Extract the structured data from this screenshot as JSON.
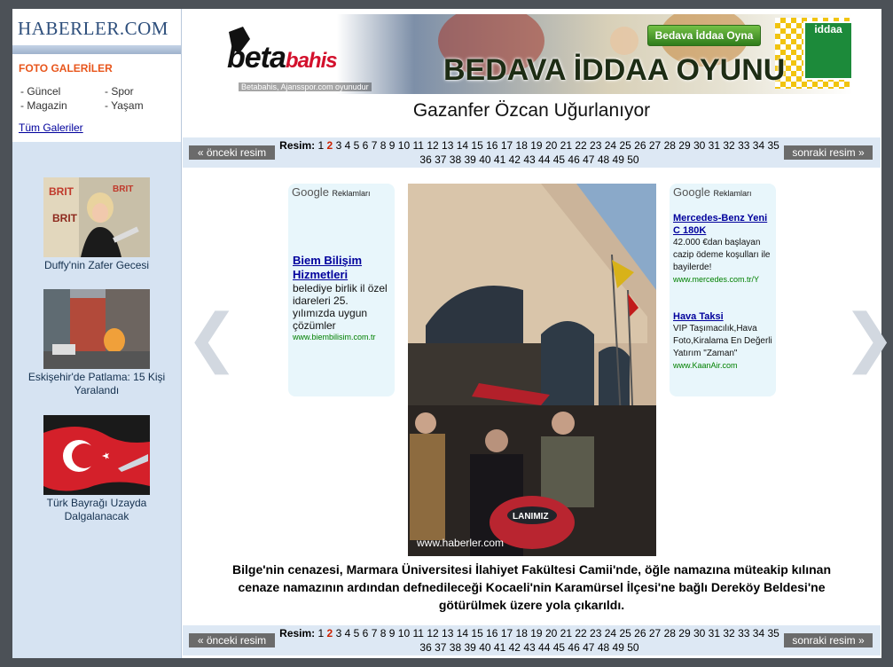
{
  "logo": "HABERLER.COM",
  "sidebar": {
    "gallery_title": "FOTO GALERİLER",
    "links": [
      "- Güncel",
      "- Spor",
      "- Magazin",
      "- Yaşam"
    ],
    "all_galleries": "Tüm Galeriler",
    "thumbs": [
      {
        "caption": "Duffy'nin Zafer Gecesi"
      },
      {
        "caption": "Eskişehir'de Patlama: 15 Kişi Yaralandı"
      },
      {
        "caption": "Türk Bayrağı Uzayda Dalgalanacak"
      }
    ]
  },
  "banner": {
    "brand": "beta",
    "brand_accent": "bahis",
    "slogan": "BEDAVA İDDAA OYUNU",
    "cta": "Bedava İddaa Oyna",
    "credit": "Betabahis, Ajansspor.com oyunudur",
    "iddaa": "iddaa"
  },
  "title": "Gazanfer Özcan Uğurlanıyor",
  "pager": {
    "prev": "« önceki resim",
    "next": "sonraki resim »",
    "label": "Resim:",
    "current": "2",
    "pages": [
      "1",
      "2",
      "3",
      "4",
      "5",
      "6",
      "7",
      "8",
      "9",
      "10",
      "11",
      "12",
      "13",
      "14",
      "15",
      "16",
      "17",
      "18",
      "19",
      "20",
      "21",
      "22",
      "23",
      "24",
      "25",
      "26",
      "27",
      "28",
      "29",
      "30",
      "31",
      "32",
      "33",
      "34",
      "35",
      "36",
      "37",
      "38",
      "39",
      "40",
      "41",
      "42",
      "43",
      "44",
      "45",
      "46",
      "47",
      "48",
      "49",
      "50"
    ]
  },
  "ads_left": {
    "header": "Google",
    "header_small": "Reklamları",
    "items": [
      {
        "title": "Biem Bilişim Hizmetleri",
        "desc": "belediye birlik il özel idareleri 25. yılımızda uygun çözümler",
        "url": "www.biembilisim.com.tr"
      }
    ]
  },
  "ads_right": {
    "header": "Google",
    "header_small": "Reklamları",
    "items": [
      {
        "title": "Mercedes-Benz Yeni C 180K",
        "desc": "42.000 €dan başlayan cazip ödeme koşulları ile bayilerde!",
        "url": "www.mercedes.com.tr/Y"
      },
      {
        "title": "Hava Taksi",
        "desc": "VIP Taşımacılık,Hava Foto,Kiralama En Değerli Yatırım \"Zaman\"",
        "url": "www.KaanAir.com"
      }
    ]
  },
  "photo": {
    "credit": "www.haberler.com"
  },
  "caption": "Bilge'nin cenazesi, Marmara Üniversitesi İlahiyet Fakültesi Camii'nde, öğle namazına müteakip kılınan cenaze namazının ardından defnedileceği Kocaeli'nin Karamürsel İlçesi'ne bağlı Dereköy Beldesi'ne götürülmek üzere yola çıkarıldı.",
  "arrows": {
    "left": "❮",
    "right": "❯"
  }
}
